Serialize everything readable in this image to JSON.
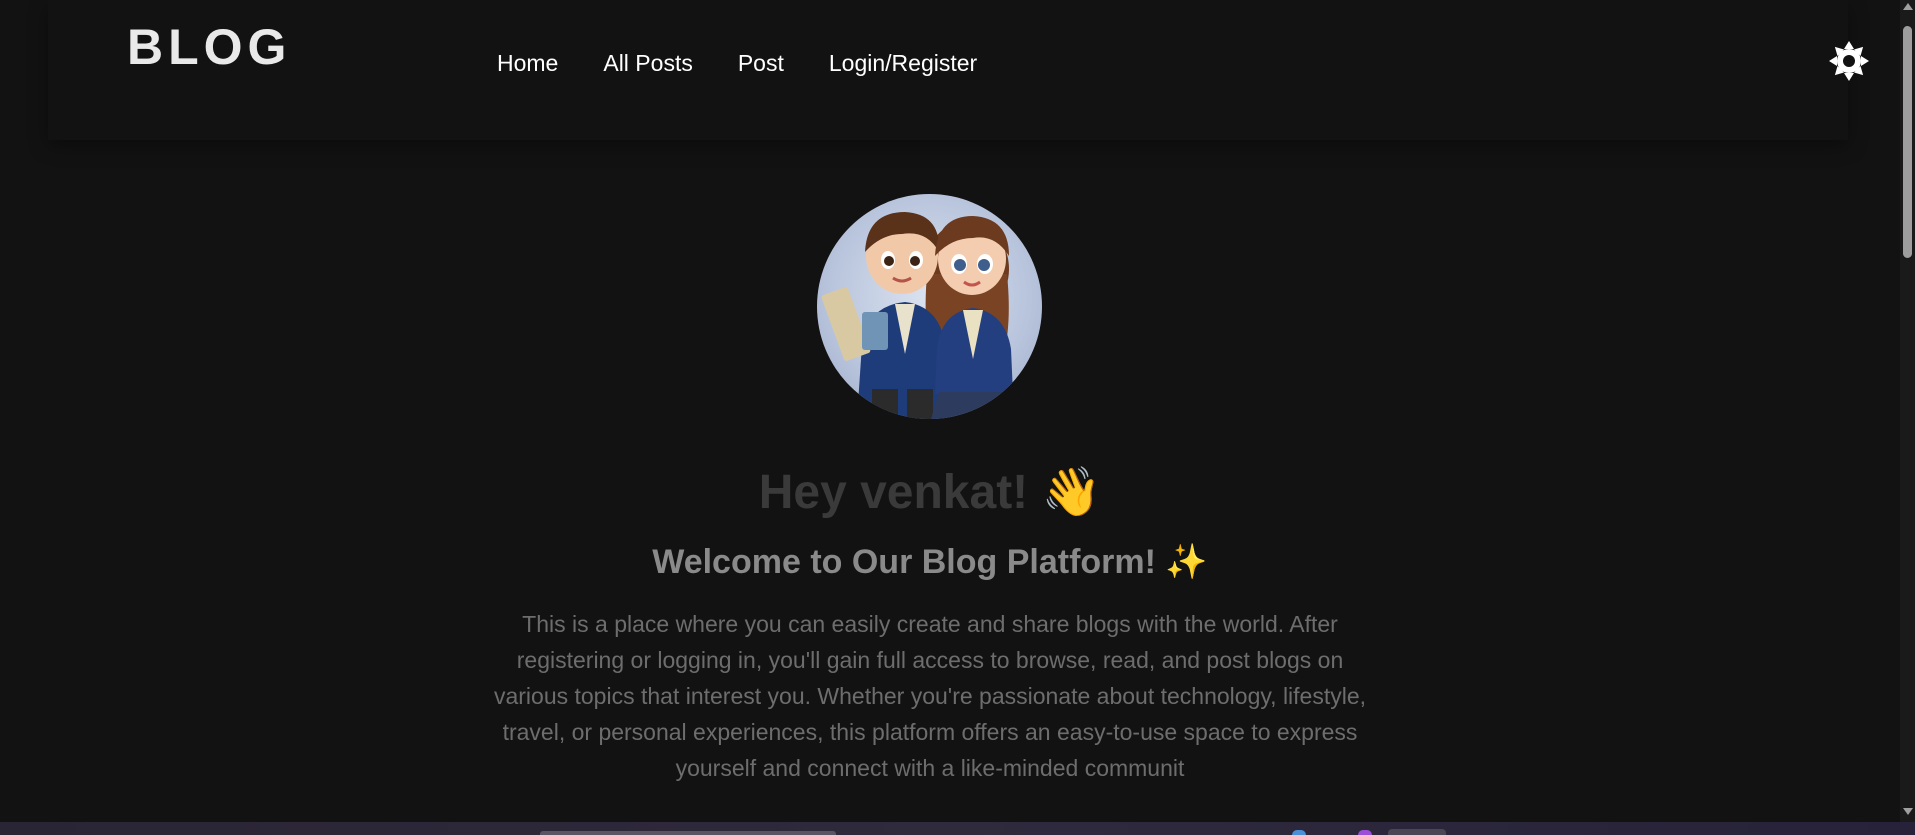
{
  "header": {
    "logo": "BLOG",
    "nav": [
      {
        "label": "Home"
      },
      {
        "label": "All Posts"
      },
      {
        "label": "Post"
      },
      {
        "label": "Login/Register"
      }
    ],
    "theme_toggle_icon": "sun-icon"
  },
  "hero": {
    "avatar_icon": "kids-illustration",
    "greeting": "Hey venkat!",
    "greeting_emoji": "👋",
    "welcome": "Welcome to Our Blog Platform!",
    "welcome_emoji": "✨",
    "description": "This is a place where you can easily create and share blogs with the world. After registering or logging in, you'll gain full access to browse, read, and post blogs on various topics that interest you. Whether you're passionate about technology, lifestyle, travel, or personal experiences, this platform offers an easy-to-use space to express yourself and connect with a like-minded communit"
  },
  "colors": {
    "background": "#121212",
    "logo": "#e9e9e9",
    "nav_text": "#ffffff",
    "greeting": "#3a3a3a",
    "welcome": "#8a8a8a",
    "description": "#6d6d6d"
  }
}
